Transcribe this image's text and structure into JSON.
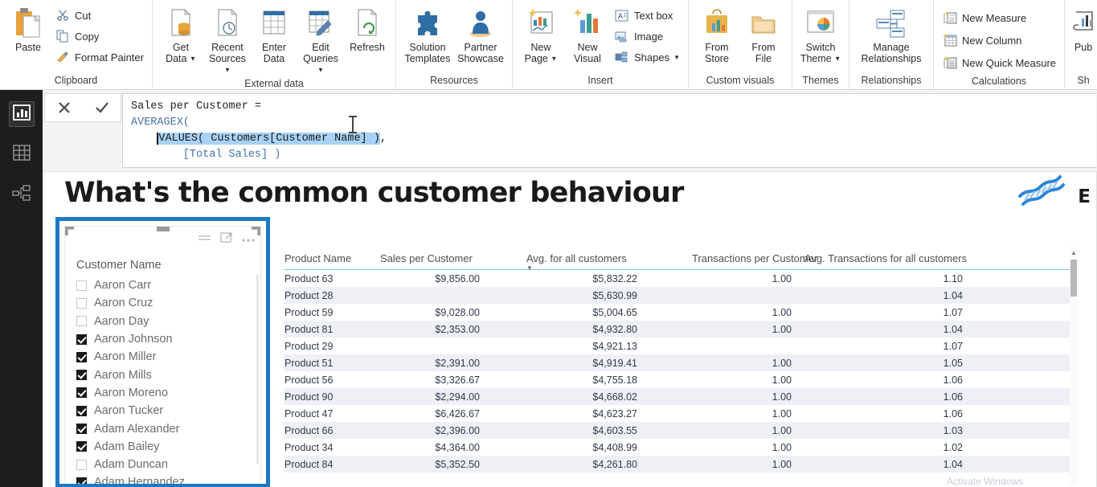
{
  "ribbon": {
    "groups": [
      {
        "label": "Clipboard",
        "big": [
          {
            "label": "Paste",
            "icon": "paste-icon"
          }
        ],
        "small": [
          {
            "label": "Cut",
            "icon": "scissors-icon"
          },
          {
            "label": "Copy",
            "icon": "copy-icon"
          },
          {
            "label": "Format Painter",
            "icon": "format-painter-icon"
          }
        ]
      },
      {
        "label": "External data",
        "big": [
          {
            "label": "Get\nData",
            "icon": "get-data-icon",
            "caret": true
          },
          {
            "label": "Recent\nSources",
            "icon": "recent-sources-icon",
            "caret": true
          },
          {
            "label": "Enter\nData",
            "icon": "enter-data-icon",
            "caret": false
          },
          {
            "label": "Edit\nQueries",
            "icon": "edit-queries-icon",
            "caret": true
          },
          {
            "label": "Refresh",
            "icon": "refresh-icon",
            "caret": false
          }
        ]
      },
      {
        "label": "Resources",
        "big": [
          {
            "label": "Solution\nTemplates",
            "icon": "solution-templates-icon"
          },
          {
            "label": "Partner\nShowcase",
            "icon": "partner-showcase-icon"
          }
        ]
      },
      {
        "label": "Insert",
        "big": [
          {
            "label": "New\nPage",
            "icon": "new-page-icon",
            "caret": true
          },
          {
            "label": "New\nVisual",
            "icon": "new-visual-icon",
            "caret": false
          }
        ],
        "small": [
          {
            "label": "Text box",
            "icon": "text-box-icon"
          },
          {
            "label": "Image",
            "icon": "image-icon"
          },
          {
            "label": "Shapes",
            "icon": "shapes-icon",
            "caret": true
          }
        ]
      },
      {
        "label": "Custom visuals",
        "big": [
          {
            "label": "From\nStore",
            "icon": "from-store-icon"
          },
          {
            "label": "From\nFile",
            "icon": "from-file-icon"
          }
        ]
      },
      {
        "label": "Themes",
        "big": [
          {
            "label": "Switch\nTheme",
            "icon": "switch-theme-icon",
            "caret": true
          }
        ]
      },
      {
        "label": "Relationships",
        "big": [
          {
            "label": "Manage\nRelationships",
            "icon": "manage-relationships-icon"
          }
        ]
      },
      {
        "label": "Calculations",
        "small": [
          {
            "label": "New Measure",
            "icon": "new-measure-icon"
          },
          {
            "label": "New Column",
            "icon": "new-column-icon"
          },
          {
            "label": "New Quick Measure",
            "icon": "new-quick-measure-icon"
          }
        ]
      },
      {
        "label": "Sh",
        "big": [
          {
            "label": "Pub",
            "icon": "publish-icon"
          }
        ]
      }
    ]
  },
  "leftnav": {
    "items": [
      {
        "name": "report-view",
        "icon": "bar-chart-icon",
        "active": true
      },
      {
        "name": "data-view",
        "icon": "table-grid-icon",
        "active": false
      },
      {
        "name": "model-view",
        "icon": "relationships-icon",
        "active": false
      }
    ]
  },
  "formula_bar": {
    "cancel_label": "✕",
    "confirm_label": "✓",
    "line1": "Sales per Customer =",
    "line2": "AVERAGEX(",
    "line3_indent": "    ",
    "line3_selected": "VALUES( Customers[Customer Name] )",
    "line3_tail": ",",
    "line4": "        [Total Sales] )"
  },
  "canvas": {
    "title": "What's the common customer behaviour",
    "decor_letter": "E",
    "watermark": "Activate Windows"
  },
  "slicer": {
    "title": "Customer Name",
    "icons": {
      "filter": "hamburger-filter-icon",
      "focus": "focus-mode-icon",
      "more": "more-options-icon"
    },
    "items": [
      {
        "label": "Aaron Carr",
        "checked": false
      },
      {
        "label": "Aaron Cruz",
        "checked": false
      },
      {
        "label": "Aaron Day",
        "checked": false
      },
      {
        "label": "Aaron Johnson",
        "checked": true
      },
      {
        "label": "Aaron Miller",
        "checked": true
      },
      {
        "label": "Aaron Mills",
        "checked": true
      },
      {
        "label": "Aaron Moreno",
        "checked": true
      },
      {
        "label": "Aaron Tucker",
        "checked": true
      },
      {
        "label": "Adam Alexander",
        "checked": true
      },
      {
        "label": "Adam Bailey",
        "checked": true
      },
      {
        "label": "Adam Duncan",
        "checked": false
      },
      {
        "label": "Adam Hernandez",
        "checked": true
      }
    ]
  },
  "table": {
    "columns": [
      "Product Name",
      "Sales per Customer",
      "Avg. for all customers",
      "Transactions per Customer",
      "Avg. Transactions for all customers"
    ],
    "sorted_column_index": 2,
    "sort_indicator": "▼",
    "rows": [
      [
        "Product 63",
        "$9,856.00",
        "$5,832.22",
        "1.00",
        "1.10"
      ],
      [
        "Product 28",
        "",
        "$5,630.99",
        "",
        "1.04"
      ],
      [
        "Product 59",
        "$9,028.00",
        "$5,004.65",
        "1.00",
        "1.07"
      ],
      [
        "Product 81",
        "$2,353.00",
        "$4,932.80",
        "1.00",
        "1.04"
      ],
      [
        "Product 29",
        "",
        "$4,921.13",
        "",
        "1.07"
      ],
      [
        "Product 51",
        "$2,391.00",
        "$4,919.41",
        "1.00",
        "1.05"
      ],
      [
        "Product 56",
        "$3,326.67",
        "$4,755.18",
        "1.00",
        "1.06"
      ],
      [
        "Product 90",
        "$2,294.00",
        "$4,668.02",
        "1.00",
        "1.06"
      ],
      [
        "Product 47",
        "$6,426.67",
        "$4,623.27",
        "1.00",
        "1.06"
      ],
      [
        "Product 66",
        "$2,396.00",
        "$4,603.55",
        "1.00",
        "1.03"
      ],
      [
        "Product 34",
        "$4,364.00",
        "$4,408.99",
        "1.00",
        "1.02"
      ],
      [
        "Product 84",
        "$5,352.50",
        "$4,261.80",
        "1.00",
        "1.04"
      ]
    ],
    "scroll_up_glyph": "▲"
  },
  "colors": {
    "selection_blue": "#1d79c4",
    "header_underline": "#7fcfc7",
    "alt_row": "#eff0f6",
    "nav_bg": "#1d1d1d",
    "formula_keyword": "#4472a8",
    "selection_highlight": "#a8d2f5"
  }
}
